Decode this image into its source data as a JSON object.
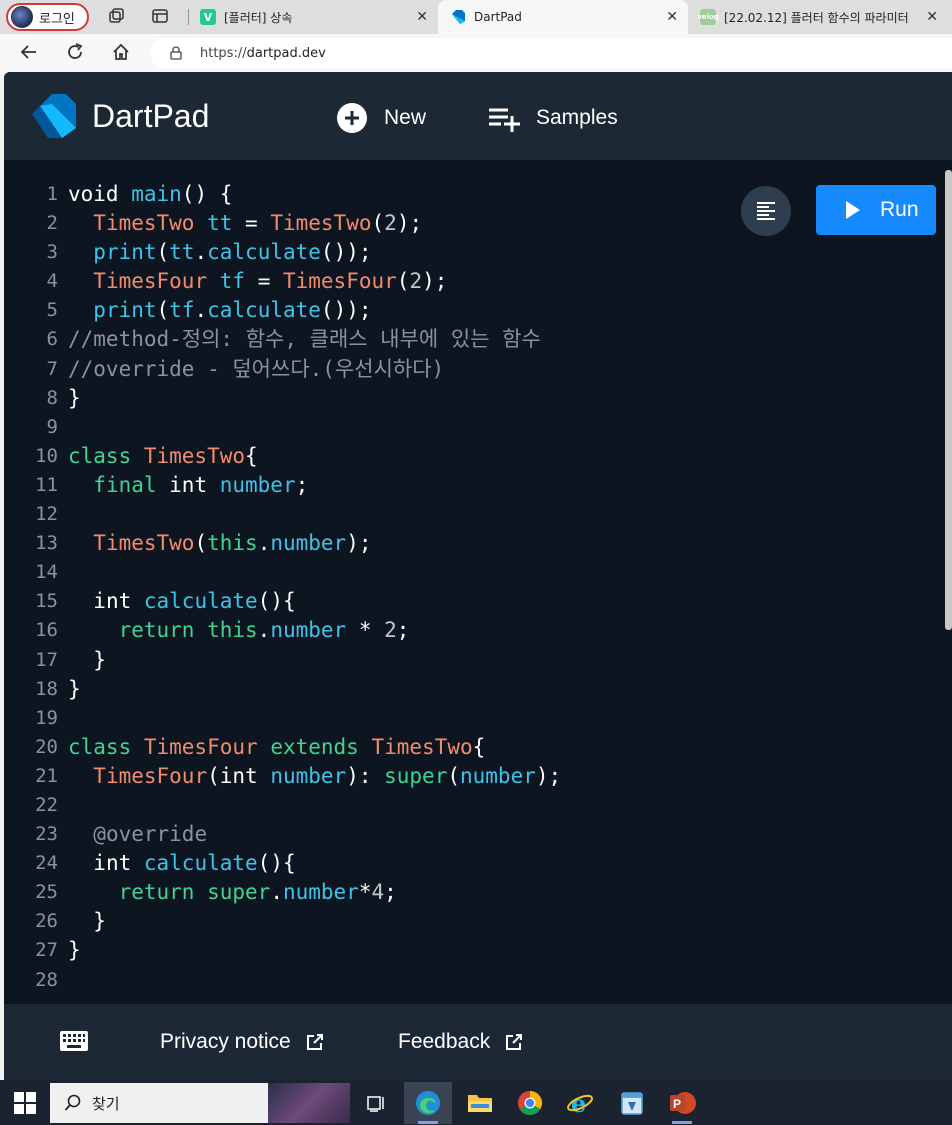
{
  "browser": {
    "profile_label": "로그인",
    "tabs": [
      {
        "title": "[플러터] 상속",
        "favicon": "V",
        "favicon_color": "#20c997"
      },
      {
        "title": "DartPad",
        "favicon": "dart",
        "favicon_color": "#0175c2"
      },
      {
        "title": "[22.02.12] 플러터 함수의 파라미터",
        "favicon": "velog",
        "favicon_color": "#9ccf9a"
      }
    ],
    "url_prefix": "https://",
    "url_host": "dartpad.dev"
  },
  "header": {
    "brand": "DartPad",
    "new_label": "New",
    "samples_label": "Samples"
  },
  "editor": {
    "run_label": "Run",
    "lines": [
      {
        "n": "1",
        "t": [
          [
            "kw",
            "void "
          ],
          [
            "fn",
            "main"
          ],
          [
            "pl",
            "() {"
          ]
        ]
      },
      {
        "n": "2",
        "t": [
          [
            "pl",
            "  "
          ],
          [
            "ty",
            "TimesTwo"
          ],
          [
            "pl",
            " "
          ],
          [
            "var",
            "tt"
          ],
          [
            "pl",
            " = "
          ],
          [
            "ty",
            "TimesTwo"
          ],
          [
            "pl",
            "("
          ],
          [
            "num",
            "2"
          ],
          [
            "pl",
            ");"
          ]
        ]
      },
      {
        "n": "3",
        "t": [
          [
            "pl",
            "  "
          ],
          [
            "fn",
            "print"
          ],
          [
            "pl",
            "("
          ],
          [
            "var",
            "tt"
          ],
          [
            "pl",
            "."
          ],
          [
            "fn",
            "calculate"
          ],
          [
            "pl",
            "());"
          ]
        ]
      },
      {
        "n": "4",
        "t": [
          [
            "pl",
            "  "
          ],
          [
            "ty",
            "TimesFour"
          ],
          [
            "pl",
            " "
          ],
          [
            "var",
            "tf"
          ],
          [
            "pl",
            " = "
          ],
          [
            "ty",
            "TimesFour"
          ],
          [
            "pl",
            "("
          ],
          [
            "num",
            "2"
          ],
          [
            "pl",
            ");"
          ]
        ]
      },
      {
        "n": "5",
        "t": [
          [
            "pl",
            "  "
          ],
          [
            "fn",
            "print"
          ],
          [
            "pl",
            "("
          ],
          [
            "var",
            "tf"
          ],
          [
            "pl",
            "."
          ],
          [
            "fn",
            "calculate"
          ],
          [
            "pl",
            "());"
          ]
        ]
      },
      {
        "n": "6",
        "t": [
          [
            "cmt",
            "//method-정의: 함수, 클래스 내부에 있는 함수"
          ]
        ]
      },
      {
        "n": "7",
        "t": [
          [
            "cmt",
            "//override - 덮어쓰다.(우선시하다)"
          ]
        ]
      },
      {
        "n": "8",
        "t": [
          [
            "pl",
            "}"
          ]
        ]
      },
      {
        "n": "9",
        "t": []
      },
      {
        "n": "10",
        "t": [
          [
            "grn",
            "class "
          ],
          [
            "ty",
            "TimesTwo"
          ],
          [
            "pl",
            "{"
          ]
        ]
      },
      {
        "n": "11",
        "t": [
          [
            "pl",
            "  "
          ],
          [
            "grn",
            "final "
          ],
          [
            "kw",
            "int "
          ],
          [
            "var",
            "number"
          ],
          [
            "pl",
            ";"
          ]
        ]
      },
      {
        "n": "12",
        "t": []
      },
      {
        "n": "13",
        "t": [
          [
            "pl",
            "  "
          ],
          [
            "ty",
            "TimesTwo"
          ],
          [
            "pl",
            "("
          ],
          [
            "grn",
            "this"
          ],
          [
            "pl",
            "."
          ],
          [
            "var",
            "number"
          ],
          [
            "pl",
            ");"
          ]
        ]
      },
      {
        "n": "14",
        "t": []
      },
      {
        "n": "15",
        "t": [
          [
            "pl",
            "  "
          ],
          [
            "kw",
            "int "
          ],
          [
            "fn",
            "calculate"
          ],
          [
            "pl",
            "(){"
          ]
        ]
      },
      {
        "n": "16",
        "t": [
          [
            "pl",
            "    "
          ],
          [
            "grn",
            "return "
          ],
          [
            "grn",
            "this"
          ],
          [
            "pl",
            "."
          ],
          [
            "var",
            "number"
          ],
          [
            "pl",
            " * "
          ],
          [
            "num",
            "2"
          ],
          [
            "pl",
            ";"
          ]
        ]
      },
      {
        "n": "17",
        "t": [
          [
            "pl",
            "  }"
          ]
        ]
      },
      {
        "n": "18",
        "t": [
          [
            "pl",
            "}"
          ]
        ]
      },
      {
        "n": "19",
        "t": []
      },
      {
        "n": "20",
        "t": [
          [
            "grn",
            "class "
          ],
          [
            "ty",
            "TimesFour"
          ],
          [
            "pl",
            " "
          ],
          [
            "grn",
            "extends "
          ],
          [
            "ty",
            "TimesTwo"
          ],
          [
            "pl",
            "{"
          ]
        ]
      },
      {
        "n": "21",
        "t": [
          [
            "pl",
            "  "
          ],
          [
            "ty",
            "TimesFour"
          ],
          [
            "pl",
            "("
          ],
          [
            "kw",
            "int "
          ],
          [
            "var",
            "number"
          ],
          [
            "pl",
            "): "
          ],
          [
            "grn",
            "super"
          ],
          [
            "pl",
            "("
          ],
          [
            "var",
            "number"
          ],
          [
            "pl",
            ");"
          ]
        ]
      },
      {
        "n": "22",
        "t": []
      },
      {
        "n": "23",
        "t": [
          [
            "pl",
            "  "
          ],
          [
            "cmt",
            "@override"
          ]
        ]
      },
      {
        "n": "24",
        "t": [
          [
            "pl",
            "  "
          ],
          [
            "kw",
            "int "
          ],
          [
            "fn",
            "calculate"
          ],
          [
            "pl",
            "(){"
          ]
        ]
      },
      {
        "n": "25",
        "t": [
          [
            "pl",
            "    "
          ],
          [
            "grn",
            "return "
          ],
          [
            "grn",
            "super"
          ],
          [
            "pl",
            "."
          ],
          [
            "var",
            "number"
          ],
          [
            "pl",
            "*"
          ],
          [
            "num",
            "4"
          ],
          [
            "pl",
            ";"
          ]
        ]
      },
      {
        "n": "26",
        "t": [
          [
            "pl",
            "  }"
          ]
        ]
      },
      {
        "n": "27",
        "t": [
          [
            "pl",
            "}"
          ]
        ]
      },
      {
        "n": "28",
        "t": []
      }
    ]
  },
  "footer": {
    "privacy_label": "Privacy notice",
    "feedback_label": "Feedback"
  },
  "taskbar": {
    "search_label": "찾기",
    "apps": [
      "task-view",
      "edge",
      "file-explorer",
      "chrome",
      "internet-explorer",
      "calendar-app",
      "powerpoint"
    ]
  }
}
